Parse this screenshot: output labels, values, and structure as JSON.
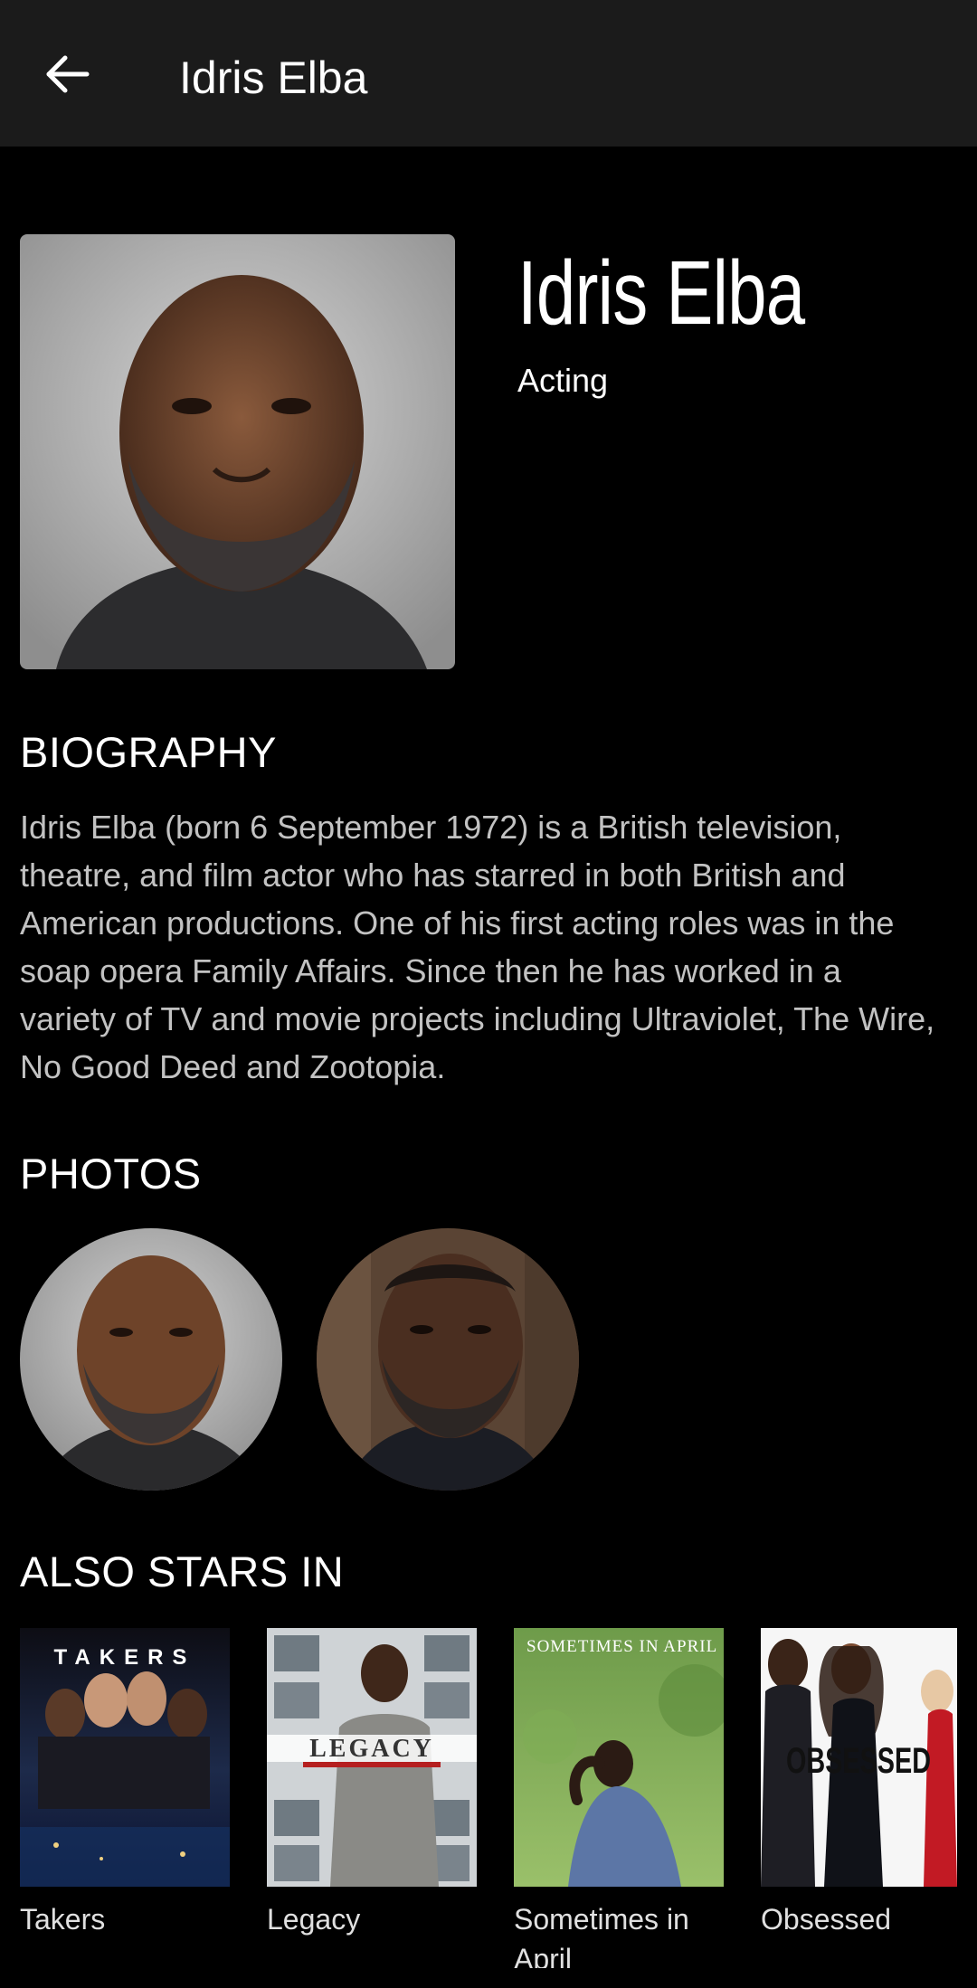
{
  "app_bar": {
    "title": "Idris Elba",
    "back_icon": "arrow-left-icon"
  },
  "person": {
    "name": "Idris Elba",
    "department": "Acting"
  },
  "biography": {
    "heading": "BIOGRAPHY",
    "text": "Idris Elba (born 6 September 1972) is a British television, theatre, and film actor who has starred in both British and American productions. One of his first acting roles was in the soap opera Family Affairs. Since then he has worked in a variety of TV and movie projects including Ultraviolet, The Wire, No Good Deed and Zootopia."
  },
  "photos": {
    "heading": "PHOTOS"
  },
  "also_stars_in": {
    "heading": "ALSO STARS IN",
    "movies": [
      {
        "title": "Takers",
        "poster_text": "TAKERS"
      },
      {
        "title": "Legacy",
        "poster_text": "LEGACY"
      },
      {
        "title": "Sometimes in April",
        "poster_text": "SOMETIMES IN APRIL"
      },
      {
        "title": "Obsessed",
        "poster_text": "OBSESSED"
      }
    ]
  }
}
